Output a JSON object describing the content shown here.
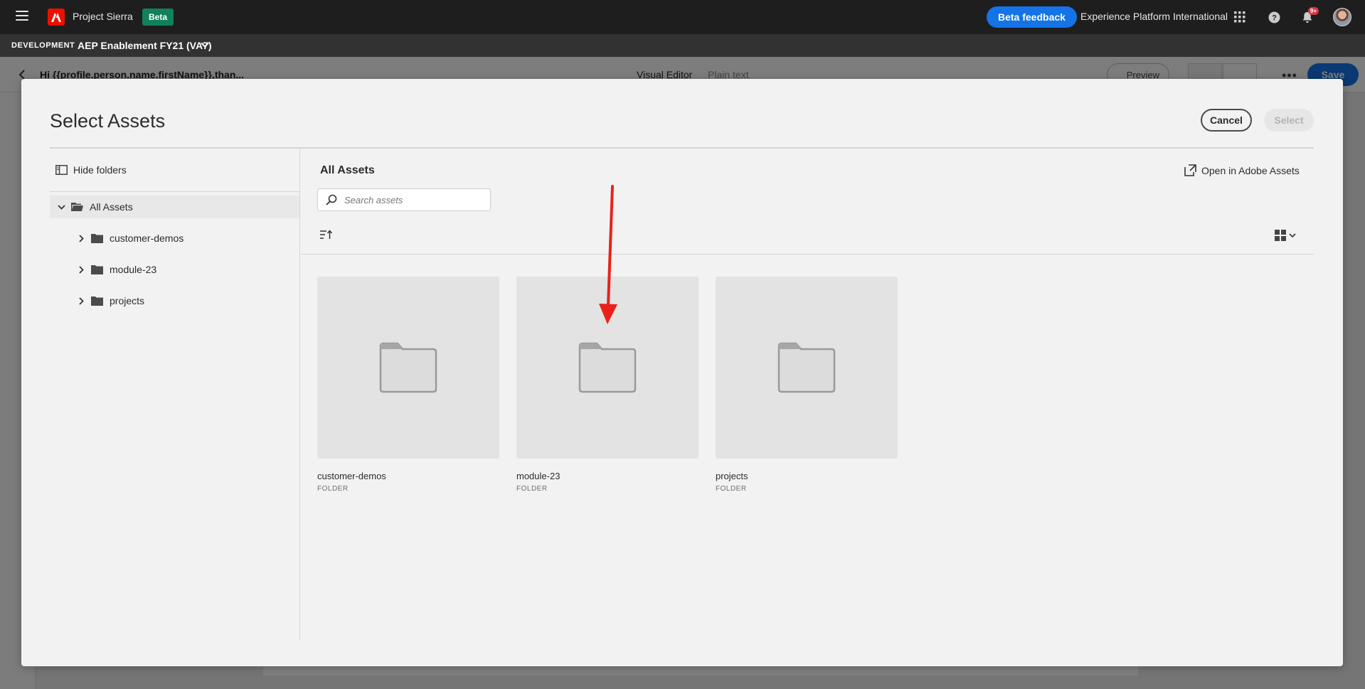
{
  "topbar": {
    "app_name": "Project Sierra",
    "beta_badge": "Beta",
    "feedback_button": "Beta feedback",
    "org_name": "Experience Platform International",
    "notification_count": "9+",
    "icons": [
      "menu-icon",
      "adobe-logo",
      "apps-grid-icon",
      "help-icon",
      "bell-icon",
      "avatar"
    ]
  },
  "sandbox": {
    "env_label": "DEVELOPMENT",
    "name": "AEP Enablement FY21 (VA7)"
  },
  "editor": {
    "subject": "Hi {{profile.person.name.firstName}},than...",
    "tabs": [
      "Visual Editor",
      "Plain text"
    ],
    "preview_label": "Preview",
    "save_label": "Save"
  },
  "modal": {
    "title": "Select Assets",
    "cancel_label": "Cancel",
    "select_label": "Select",
    "hide_folders_label": "Hide folders",
    "tree": {
      "root": "All Assets",
      "children": [
        "customer-demos",
        "module-23",
        "projects"
      ]
    },
    "main_title": "All Assets",
    "open_in_label": "Open in Adobe Assets",
    "search_placeholder": "Search assets",
    "cards": [
      {
        "name": "customer-demos",
        "type": "FOLDER"
      },
      {
        "name": "module-23",
        "type": "FOLDER"
      },
      {
        "name": "projects",
        "type": "FOLDER"
      }
    ],
    "annotation": "red-arrow-pointing-to-module-23"
  },
  "colors": {
    "accent": "#1473e6",
    "brand_red": "#eb1000",
    "beta_green": "#12805c",
    "annotation_red": "#e8221b"
  }
}
